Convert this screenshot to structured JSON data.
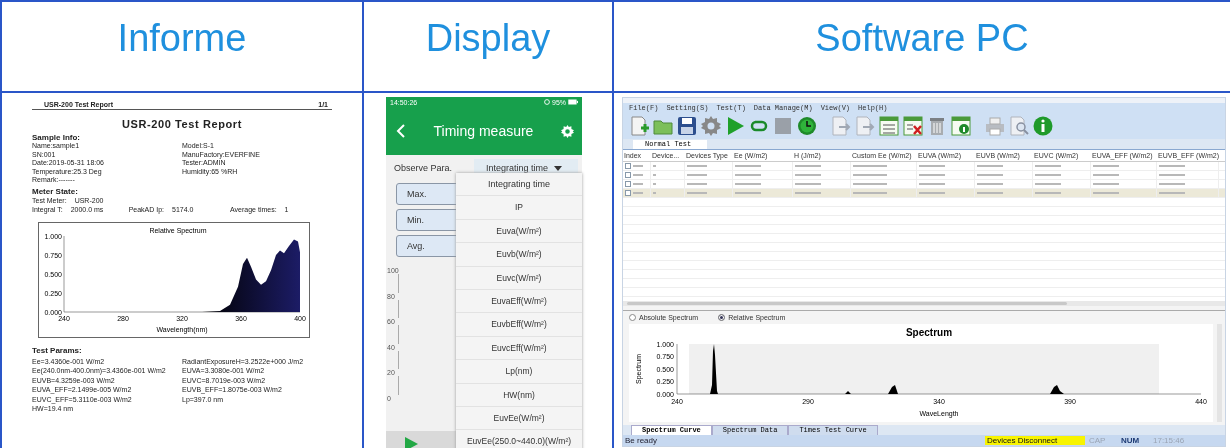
{
  "header_row": [
    {
      "title": "Informe"
    },
    {
      "title": "Display"
    },
    {
      "title": "Software PC"
    }
  ],
  "report": {
    "running_head": "USR-200 Test Report",
    "page": "1/1",
    "title": "USR-200 Test Report",
    "sample_heading": "Sample Info:",
    "sample_left": [
      "Name:sample1",
      "SN:001",
      "Date:2019-05-31 18:06",
      "Temperature:25.3 Deg",
      "Remark:-------"
    ],
    "sample_right": [
      "Model:S-1",
      "ManuFactory:EVERFINE",
      "Tester:ADMIN",
      "Humidity:65 %RH"
    ],
    "meter_heading": "Meter State:",
    "meter_line1": [
      "Test Meter:",
      "USR-200"
    ],
    "meter_line2": [
      "Integral T:",
      "2000.0 ms",
      "PeakAD Ip:",
      "5174.0",
      "Average times:",
      "1"
    ],
    "chart": {
      "title": "Relative Spectrum",
      "yticks": [
        "1.000",
        "0.750",
        "0.500",
        "0.250",
        "0.000"
      ],
      "xticks": [
        "240",
        "280",
        "320",
        "360",
        "400"
      ],
      "xlabel": "Wavelength(nm)"
    },
    "params_heading": "Test Params:",
    "params_left": [
      "Ee=3.4360e-001 W/m2",
      "Ee(240.0nm-400.0nm)=3.4360e-001 W/m2",
      "EUVB=4.3259e-003 W/m2",
      "EUVA_EFF=2.1499e-005 W/m2",
      "EUVC_EFF=5.3110e-003 W/m2",
      "HW=19.4 nm"
    ],
    "params_right": [
      "RadiantExposureH=3.2522e+000 J/m2",
      "EUVA=3.3080e-001 W/m2",
      "EUVC=8.7019e-003 W/m2",
      "EUVB_EFF=1.8075e-003 W/m2",
      "Lp=397.0 nm"
    ]
  },
  "display": {
    "time": "14:50:26",
    "battery": "95%",
    "title": "Timing measure",
    "observe_label": "Observe Para.",
    "observe_value": "Integrating time",
    "stat_buttons": [
      "Max.",
      "Min.",
      "Avg."
    ],
    "yticks": [
      "100",
      "80",
      "60",
      "40",
      "20",
      "0"
    ],
    "options": [
      "Integrating time",
      "IP",
      "Euva(W/m²)",
      "Euvb(W/m²)",
      "Euvc(W/m²)",
      "EuvaEff(W/m²)",
      "EuvbEff(W/m²)",
      "EuvcEff(W/m²)",
      "Lp(nm)",
      "HW(nm)",
      "EuvEe(W/m²)",
      "EuvEe(250.0~440.0)(W/m²)"
    ]
  },
  "software": {
    "menu": [
      "File(F)",
      "Setting(S)",
      "Test(T)",
      "Data Manage(M)",
      "View(V)",
      "Help(H)"
    ],
    "tab": "Normal Test",
    "columns": [
      "Index",
      "Device...",
      "Devices Type",
      "Ee (W/m2)",
      "H (J/m2)",
      "Custom Ee (W/m2)",
      "EUVA (W/m2)",
      "EUVB (W/m2)",
      "EUVC (W/m2)",
      "EUVA_EFF (W/m2)",
      "EUVB_EFF (W/m2)"
    ],
    "rows": [
      {
        "checked": false,
        "selected": false
      },
      {
        "checked": false,
        "selected": false
      },
      {
        "checked": false,
        "selected": false
      },
      {
        "checked": false,
        "selected": true
      }
    ],
    "spectrum_modes": [
      {
        "label": "Absolute Spectrum",
        "selected": false
      },
      {
        "label": "Relative Spectrum",
        "selected": true
      }
    ],
    "chart": {
      "title": "Spectrum",
      "ylabel": "Spectrum",
      "yticks": [
        "1.000",
        "0.750",
        "0.500",
        "0.250",
        "0.000"
      ],
      "xticks": [
        "240",
        "290",
        "340",
        "390",
        "440"
      ],
      "xlabel": "WaveLength"
    },
    "bottom_tabs": [
      {
        "label": "Spectrum Curve",
        "selected": true
      },
      {
        "label": "Spectrum Data",
        "selected": false
      },
      {
        "label": "Times Test Curve",
        "selected": false
      }
    ],
    "status": {
      "message": "Be ready",
      "connection": "Devices Disconnect",
      "indicators": [
        {
          "label": "CAP",
          "on": false
        },
        {
          "label": "NUM",
          "on": true
        }
      ],
      "time": "17:15:46"
    }
  }
}
